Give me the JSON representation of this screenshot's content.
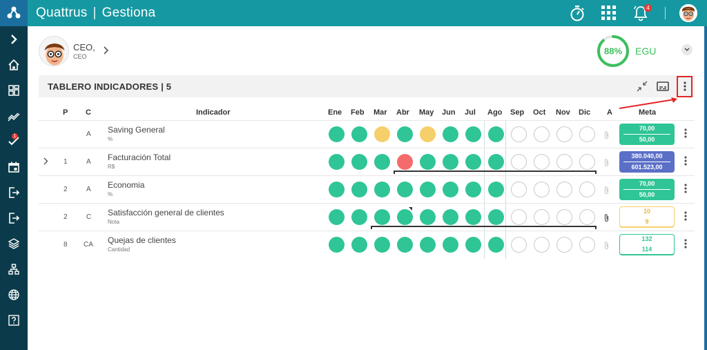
{
  "app": {
    "brand_name": "Quattrus",
    "brand_separator": "|",
    "brand_module": "Gestiona",
    "notification_count": "4",
    "sidebar_badge": "1"
  },
  "user": {
    "name": "CEO,",
    "role": "CEO"
  },
  "egu": {
    "percent": "88%",
    "value": 0.88,
    "label": "EGU"
  },
  "board": {
    "title": "TABLERO INDICADORES | 5"
  },
  "columns": {
    "p": "P",
    "c": "C",
    "indicator": "Indicador",
    "months": [
      "Ene",
      "Feb",
      "Mar",
      "Abr",
      "May",
      "Jun",
      "Jul",
      "Ago",
      "Sep",
      "Oct",
      "Nov",
      "Dic"
    ],
    "a": "A",
    "meta": "Meta"
  },
  "rows": [
    {
      "p": "",
      "c": "A",
      "name": "Saving General",
      "unit": "%",
      "months": [
        "g",
        "g",
        "y",
        "g",
        "y",
        "g",
        "g",
        "g",
        "e",
        "e",
        "e",
        "e"
      ],
      "meta_top": "70,00",
      "meta_bottom": "50,00",
      "meta_style": "green",
      "expand": false
    },
    {
      "p": "1",
      "c": "A",
      "name": "Facturación Total",
      "unit": "R$",
      "months": [
        "g",
        "g",
        "g",
        "r",
        "g",
        "g",
        "g",
        "g",
        "e",
        "e",
        "e",
        "e"
      ],
      "meta_top": "380.040,00",
      "meta_bottom": "601.523,00",
      "meta_style": "blue",
      "expand": true
    },
    {
      "p": "2",
      "c": "A",
      "name": "Economia",
      "unit": "%",
      "months": [
        "g",
        "g",
        "g",
        "g",
        "g",
        "g",
        "g",
        "g",
        "e",
        "e",
        "e",
        "e"
      ],
      "meta_top": "70,00",
      "meta_bottom": "50,00",
      "meta_style": "green",
      "expand": false
    },
    {
      "p": "2",
      "c": "C",
      "name": "Satisfacción general de clientes",
      "unit": "Nota",
      "months": [
        "g",
        "g",
        "g",
        "g",
        "g",
        "g",
        "g",
        "g",
        "e",
        "e",
        "e",
        "e"
      ],
      "meta_top": "10",
      "meta_bottom": "9",
      "meta_style": "ow",
      "expand": false
    },
    {
      "p": "8",
      "c": "CA",
      "name": "Quejas de clientes",
      "unit": "Cantidad",
      "months": [
        "g",
        "g",
        "g",
        "g",
        "g",
        "g",
        "g",
        "g",
        "e",
        "e",
        "e",
        "e"
      ],
      "meta_top": "132",
      "meta_bottom": "114",
      "meta_style": "gw",
      "expand": false
    }
  ],
  "colors": {
    "teal_bar": "#1598a1",
    "sidebar": "#0b3b4a",
    "green": "#2fc596",
    "yellow": "#f5cf69",
    "red": "#f56b6b",
    "blue_meta": "#5b6fc7",
    "highlight": "#e32626"
  },
  "icons": {
    "timer": "stopwatch-icon",
    "apps": "apps-grid-icon",
    "bell": "bell-icon",
    "more": "more-vertical-icon",
    "compress": "compress-icon",
    "caption": "subtitles-icon"
  }
}
